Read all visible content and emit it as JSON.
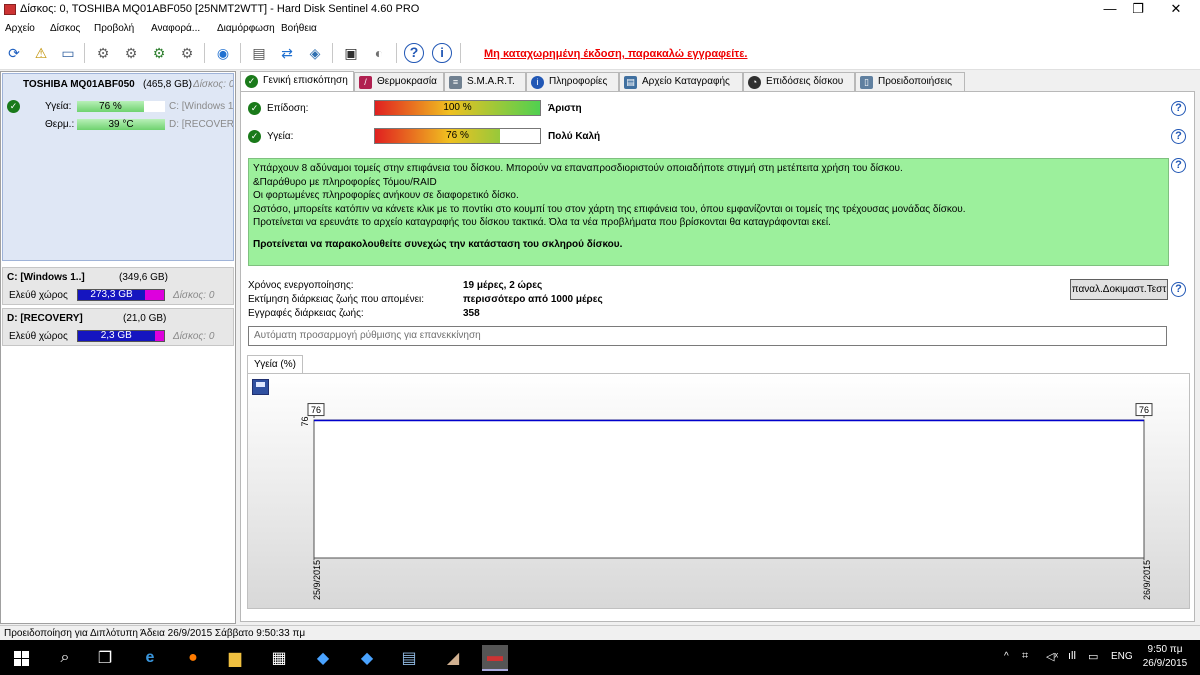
{
  "window": {
    "title": "Δίσκος: 0, TOSHIBA MQ01ABF050 [25NMT2WTT]  -  Hard Disk Sentinel 4.60 PRO",
    "minimize": "—",
    "maximize": "❐",
    "close": "✕"
  },
  "menu": [
    "Αρχείο",
    "Δίσκος",
    "Προβολή",
    "Αναφορά...",
    "Διαμόρφωση",
    "Βοήθεια"
  ],
  "toolbar": {
    "unregistered": "Μη καταχωρημένη έκδοση, παρακαλώ εγγραφείτε."
  },
  "disk": {
    "name": "TOSHIBA MQ01ABF050",
    "size": "(465,8 GB)",
    "disk_label": "Δίσκος: 0",
    "health_label": "Υγεία:",
    "health_value": "76 %",
    "health_pct": 76,
    "temp_label": "Θερμ.:",
    "temp_value": "39 °C",
    "part1_ref": "C: [Windows 1",
    "part2_ref": "D: [RECOVERY]"
  },
  "partitions": [
    {
      "name": "C: [Windows 1..]",
      "size": "(349,6 GB)",
      "free_label": "Ελεύθ χώρος",
      "free_value": "273,3 GB",
      "free_pct": 78,
      "disk": "Δίσκος: 0"
    },
    {
      "name": "D: [RECOVERY]",
      "size": "(21,0 GB)",
      "free_label": "Ελεύθ χώρος",
      "free_value": "2,3 GB",
      "free_pct": 89,
      "disk": "Δίσκος: 0"
    }
  ],
  "tabs": [
    "Γενική επισκόπηση",
    "Θερμοκρασία",
    "S.M.A.R.T.",
    "Πληροφορίες",
    "Αρχείο Καταγραφής",
    "Επιδόσεις δίσκου",
    "Προειδοποιήσεις"
  ],
  "overview": {
    "perf_label": "Επίδοση:",
    "perf_value": "100 %",
    "perf_pct": 100,
    "perf_rating": "Άριστη",
    "health_label": "Υγεία:",
    "health_value": "76 %",
    "health_pct": 76,
    "health_rating": "Πολύ Καλή",
    "message": [
      "Υπάρχουν 8 αδύναμοι τομείς στην επιφάνεια του δίσκου. Μπορούν να επαναπροσδιοριστούν οποιαδήποτε στιγμή στη μετέπειτα χρήση του δίσκου.",
      "&Παράθυρο με πληροφορίες Τόμου/RAID",
      "Οι φορτωμένες πληροφορίες ανήκουν σε διαφορετικό δίσκο.",
      "Ωστόσο, μπορείτε κατόπιν να κάνετε κλικ με το ποντίκι στο κουμπί του  στον  χάρτη της επιφάνεια του, όπου εμφανίζονται οι τομείς της τρέχουσας μονάδας δίσκου.",
      "Προτείνεται να ερευνάτε το αρχείο καταγραφής του δίσκου τακτικά. Όλα τα νέα προβλήματα που βρίσκονται θα καταγράφονται εκεί."
    ],
    "message_bold": "Προτείνεται να παρακολουθείτε συνεχώς την κατάσταση του σκληρού δίσκου.",
    "uptime_label": "Χρόνος ενεργοποίησης:",
    "uptime_value": "19 μέρες, 2 ώρες",
    "lifetime_label": "Εκτίμηση διάρκειας ζωής που απομένει:",
    "lifetime_value": "περισσότερο από 1000 μέρες",
    "records_label": "Εγγραφές διάρκειας ζωής:",
    "records_value": "358",
    "test_button": "παναλ.Δοκιμαστ.Τεστ",
    "auto_text": "Αυτόματη προσαρμογή ρύθμισης για επανεκκίνηση",
    "chart_tab": "Υγεία (%)"
  },
  "chart_data": {
    "type": "line",
    "x": [
      "25/9/2015",
      "26/9/2015"
    ],
    "series": [
      {
        "values": [
          76,
          76
        ]
      }
    ],
    "point_labels": [
      "76",
      "76"
    ],
    "y_tick": "76",
    "ylim": [
      0,
      100
    ],
    "color": "#0000cc"
  },
  "statusbar": {
    "text": "Προειδοποίηση για Διπλότυπη  Άδεια 26/9/2015 Σάββατο 9:50:33 πμ"
  },
  "taskbar": {
    "lang": "ENG",
    "time": "9:50 πμ",
    "date": "26/9/2015"
  },
  "colors": {
    "health_green": "#6fd26f",
    "message_bg": "#9cf09c",
    "free_space": "#1515c0",
    "used_space": "#dd00dd",
    "unregistered_red": "#ee0000"
  }
}
